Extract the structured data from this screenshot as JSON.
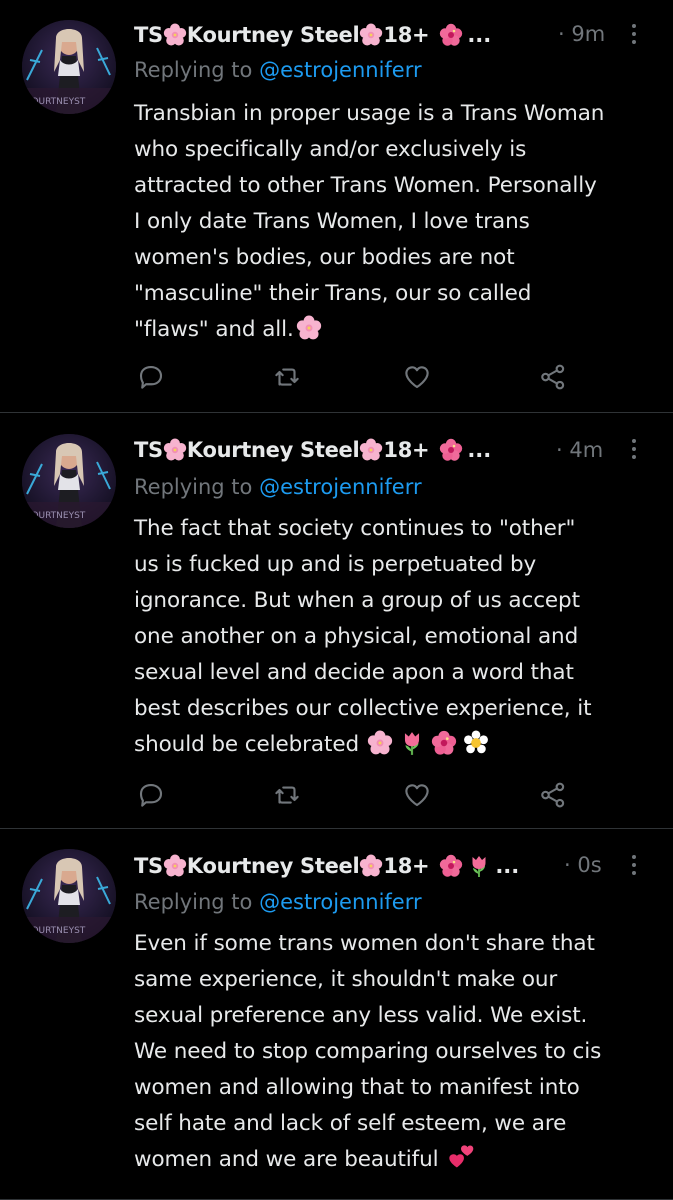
{
  "colors": {
    "background": "#000000",
    "text": "#e7e9ea",
    "secondary": "#71767b",
    "link": "#1d9bf0",
    "divider": "#2f3336"
  },
  "tweets": [
    {
      "author_prefix": "TS",
      "author_name": "Kourtney Steel",
      "author_suffix": "18+",
      "ellipsis": "...",
      "time": "· 9m",
      "reply_prefix": "Replying to ",
      "reply_handle": "@estrojenniferr",
      "lines": [
        "Transbian in proper usage is a Trans Woman",
        "who specifically and/or exclusively is",
        "attracted to other Trans Women. Personally",
        "I only date Trans Women, I love trans",
        "women's bodies, our bodies are not",
        "\"masculine\" their Trans, our so called",
        "\"flaws\" and all."
      ],
      "trailing_emoji": [
        "cherry-blossom"
      ],
      "name_emoji": [
        "hibiscus"
      ],
      "action_icons": [
        "reply-icon",
        "retweet-icon",
        "like-icon",
        "share-icon"
      ]
    },
    {
      "author_prefix": "TS",
      "author_name": "Kourtney Steel",
      "author_suffix": "18+",
      "ellipsis": "...",
      "time": "· 4m",
      "reply_prefix": "Replying to ",
      "reply_handle": "@estrojenniferr",
      "lines": [
        "The fact that society continues to \"other\"",
        "us is fucked up and  is perpetuated by",
        "ignorance. But when a group of us accept",
        "one another on a physical, emotional and",
        "sexual level and decide apon a word that",
        "best describes our collective experience, it",
        "should be celebrated"
      ],
      "trailing_emoji": [
        "cherry-blossom",
        "tulip",
        "hibiscus",
        "blossom"
      ],
      "name_emoji": [
        "hibiscus"
      ],
      "action_icons": [
        "reply-icon",
        "retweet-icon",
        "like-icon",
        "share-icon"
      ]
    },
    {
      "author_prefix": "TS",
      "author_name": "Kourtney Steel",
      "author_suffix": "18+",
      "ellipsis": "...",
      "time": "· 0s",
      "reply_prefix": "Replying to ",
      "reply_handle": "@estrojenniferr",
      "lines": [
        "Even if some trans women don't share that",
        "same experience, it shouldn't make our",
        "sexual preference any less valid. We exist.",
        "We need to stop comparing ourselves to cis",
        "women and allowing that to manifest into",
        "self hate and lack of self esteem, we are",
        "women and we are beautiful"
      ],
      "trailing_emoji": [
        "two-hearts"
      ],
      "name_emoji": [
        "hibiscus",
        "tulip"
      ],
      "action_icons": []
    }
  ]
}
